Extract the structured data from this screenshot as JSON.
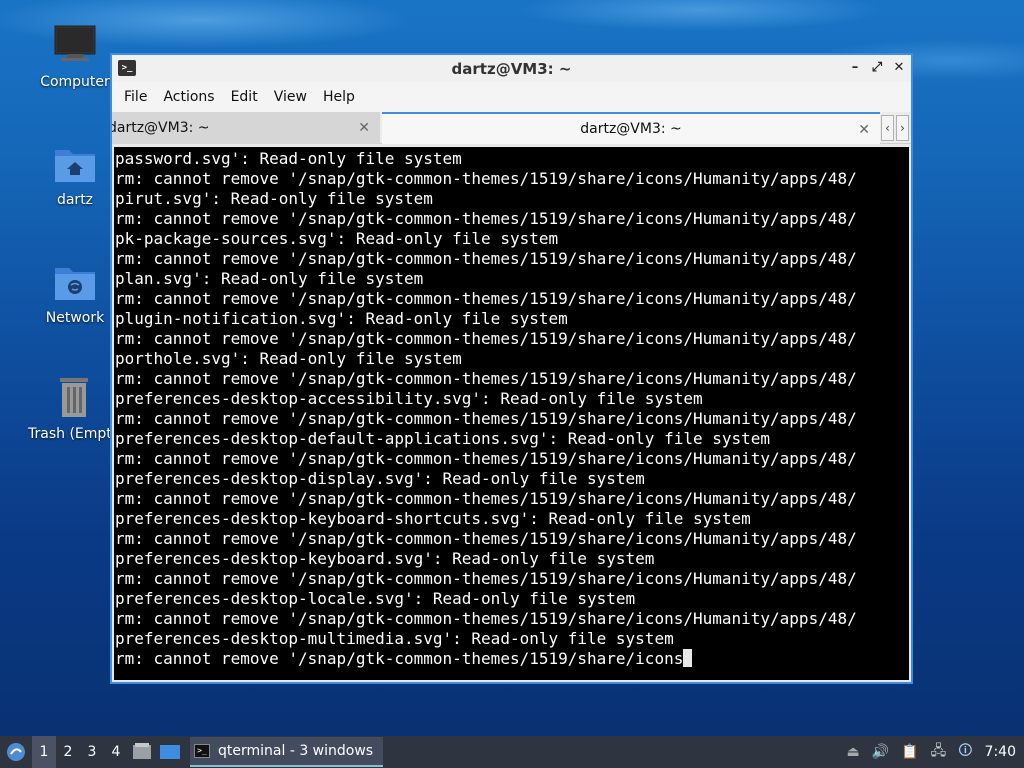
{
  "desktop": {
    "icons": [
      {
        "label": "Computer"
      },
      {
        "label": "dartz"
      },
      {
        "label": "Network"
      },
      {
        "label": "Trash (Empty)"
      }
    ]
  },
  "window": {
    "title": "dartz@VM3: ~",
    "menu": [
      "File",
      "Actions",
      "Edit",
      "View",
      "Help"
    ],
    "tabs": [
      {
        "label": "dartz@VM3: ~",
        "active": false
      },
      {
        "label": "dartz@VM3: ~",
        "active": true
      }
    ],
    "terminal_lines": [
      "password.svg': Read-only file system",
      "rm: cannot remove '/snap/gtk-common-themes/1519/share/icons/Humanity/apps/48/",
      "pirut.svg': Read-only file system",
      "rm: cannot remove '/snap/gtk-common-themes/1519/share/icons/Humanity/apps/48/",
      "pk-package-sources.svg': Read-only file system",
      "rm: cannot remove '/snap/gtk-common-themes/1519/share/icons/Humanity/apps/48/",
      "plan.svg': Read-only file system",
      "rm: cannot remove '/snap/gtk-common-themes/1519/share/icons/Humanity/apps/48/",
      "plugin-notification.svg': Read-only file system",
      "rm: cannot remove '/snap/gtk-common-themes/1519/share/icons/Humanity/apps/48/",
      "porthole.svg': Read-only file system",
      "rm: cannot remove '/snap/gtk-common-themes/1519/share/icons/Humanity/apps/48/",
      "preferences-desktop-accessibility.svg': Read-only file system",
      "rm: cannot remove '/snap/gtk-common-themes/1519/share/icons/Humanity/apps/48/",
      "preferences-desktop-default-applications.svg': Read-only file system",
      "rm: cannot remove '/snap/gtk-common-themes/1519/share/icons/Humanity/apps/48/",
      "preferences-desktop-display.svg': Read-only file system",
      "rm: cannot remove '/snap/gtk-common-themes/1519/share/icons/Humanity/apps/48/",
      "preferences-desktop-keyboard-shortcuts.svg': Read-only file system",
      "rm: cannot remove '/snap/gtk-common-themes/1519/share/icons/Humanity/apps/48/",
      "preferences-desktop-keyboard.svg': Read-only file system",
      "rm: cannot remove '/snap/gtk-common-themes/1519/share/icons/Humanity/apps/48/",
      "preferences-desktop-locale.svg': Read-only file system",
      "rm: cannot remove '/snap/gtk-common-themes/1519/share/icons/Humanity/apps/48/",
      "preferences-desktop-multimedia.svg': Read-only file system"
    ],
    "terminal_last_line": "rm: cannot remove '/snap/gtk-common-themes/1519/share/icons"
  },
  "taskbar": {
    "workspaces": [
      "1",
      "2",
      "3",
      "4"
    ],
    "active_workspace": "1",
    "task_label": "qterminal - 3 windows",
    "clock": "7:40"
  },
  "colors": {
    "accent": "#3d8ee0",
    "taskbar": "#2e3440",
    "terminal_bg": "#000000"
  }
}
